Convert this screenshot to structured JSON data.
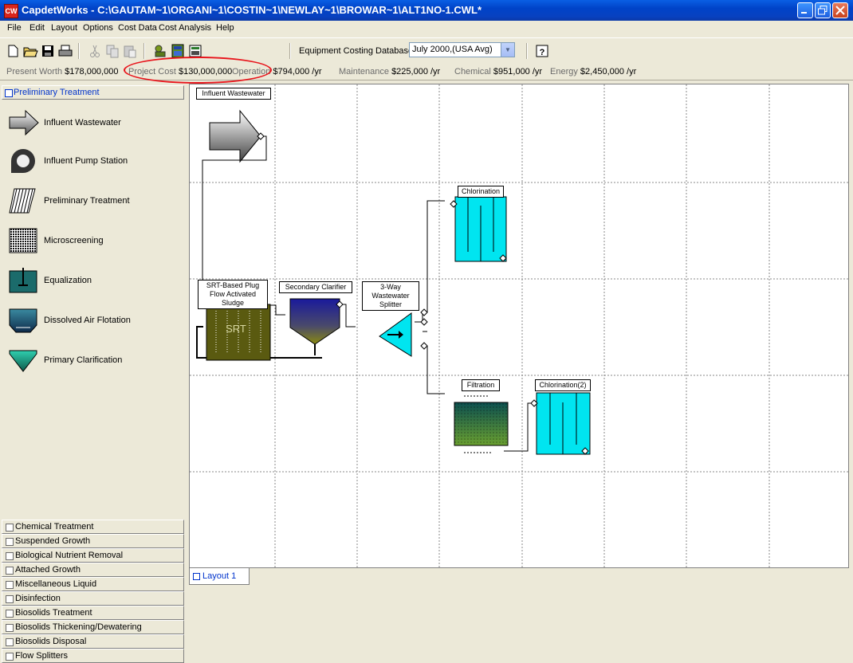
{
  "window": {
    "app_icon_text": "CW",
    "title": "CapdetWorks - C:\\GAUTAM~1\\ORGANI~1\\COSTIN~1\\NEWLAY~1\\BROWAR~1\\ALT1NO-1.CWL*"
  },
  "menu": [
    "File",
    "Edit",
    "Layout",
    "Options",
    "Cost Data",
    "Cost Analysis",
    "Help"
  ],
  "toolbar": {
    "db_label": "Equipment Costing Database :",
    "db_value": "July 2000,(USA Avg)"
  },
  "costs": [
    {
      "label": "Present Worth",
      "value": "$178,000,000"
    },
    {
      "label": "Project Cost",
      "value": "$130,000,000"
    },
    {
      "label": "Operation",
      "value": "$794,000 /yr"
    },
    {
      "label": "Maintenance",
      "value": "$225,000 /yr"
    },
    {
      "label": "Chemical",
      "value": "$951,000 /yr"
    },
    {
      "label": "Energy",
      "value": "$2,450,000 /yr"
    }
  ],
  "sidebar": {
    "active_group": "Preliminary Treatment",
    "palette": [
      {
        "label": "Influent Wastewater",
        "icon": "arrow-icon"
      },
      {
        "label": "Influent Pump Station",
        "icon": "pump-icon"
      },
      {
        "label": "Preliminary Treatment",
        "icon": "screen-icon"
      },
      {
        "label": "Microscreening",
        "icon": "microscreen-icon"
      },
      {
        "label": "Equalization",
        "icon": "basin-icon"
      },
      {
        "label": "Dissolved Air Flotation",
        "icon": "flotation-icon"
      },
      {
        "label": "Primary Clarification",
        "icon": "clarifier-icon"
      }
    ],
    "groups": [
      "Chemical Treatment",
      "Suspended Growth",
      "Biological Nutrient Removal",
      "Attached Growth",
      "Miscellaneous Liquid",
      "Disinfection",
      "Biosolids Treatment",
      "Biosolids Thickening/Dewatering",
      "Biosolids Disposal",
      "Flow Splitters"
    ]
  },
  "layout": {
    "units": {
      "influent": "Influent Wastewater",
      "plug_flow": "SRT-Based Plug Flow Activated Sludge",
      "srt": "SRT",
      "clarifier": "Secondary Clarifier",
      "splitter": "3-Way Wastewater Splitter",
      "chlorination1": "Chlorination",
      "filtration": "Filtration",
      "chlorination2": "Chlorination(2)"
    },
    "colors": {
      "cyan": "#00e5f0",
      "olive": "#5a5a10",
      "navy": "#1a1a8c"
    }
  },
  "tabs": [
    "Layout 1"
  ]
}
